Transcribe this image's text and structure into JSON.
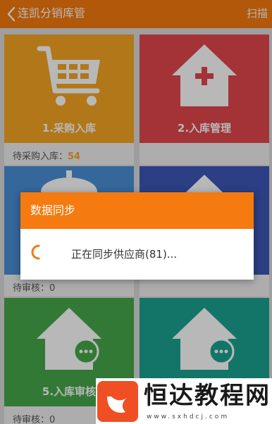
{
  "header": {
    "title": "连凯分销库管",
    "scan_label": "扫描"
  },
  "tiles": [
    {
      "label": "1.采购入库",
      "footer_label": "待采购入库：",
      "footer_value": "54",
      "color": "#f5a623"
    },
    {
      "label": "2.入库管理",
      "footer_label": "",
      "footer_value": "",
      "color": "#e2474b"
    },
    {
      "label": "",
      "footer_label": "待审核：",
      "footer_value": "0",
      "color": "#4a8fd6"
    },
    {
      "label": "",
      "footer_label": "",
      "footer_value": "",
      "color": "#3e57b7"
    },
    {
      "label": "5.入库审核",
      "footer_label": "待审核：",
      "footer_value": "0",
      "color": "#46a84b"
    },
    {
      "label": "",
      "footer_label": "",
      "footer_value": "",
      "color": "#1ba38f"
    }
  ],
  "dialog": {
    "title": "数据同步",
    "message": "正在同步供应商(81)..."
  },
  "watermark": {
    "text": "恒达教程网",
    "url": "www.sxhdcj.com"
  }
}
